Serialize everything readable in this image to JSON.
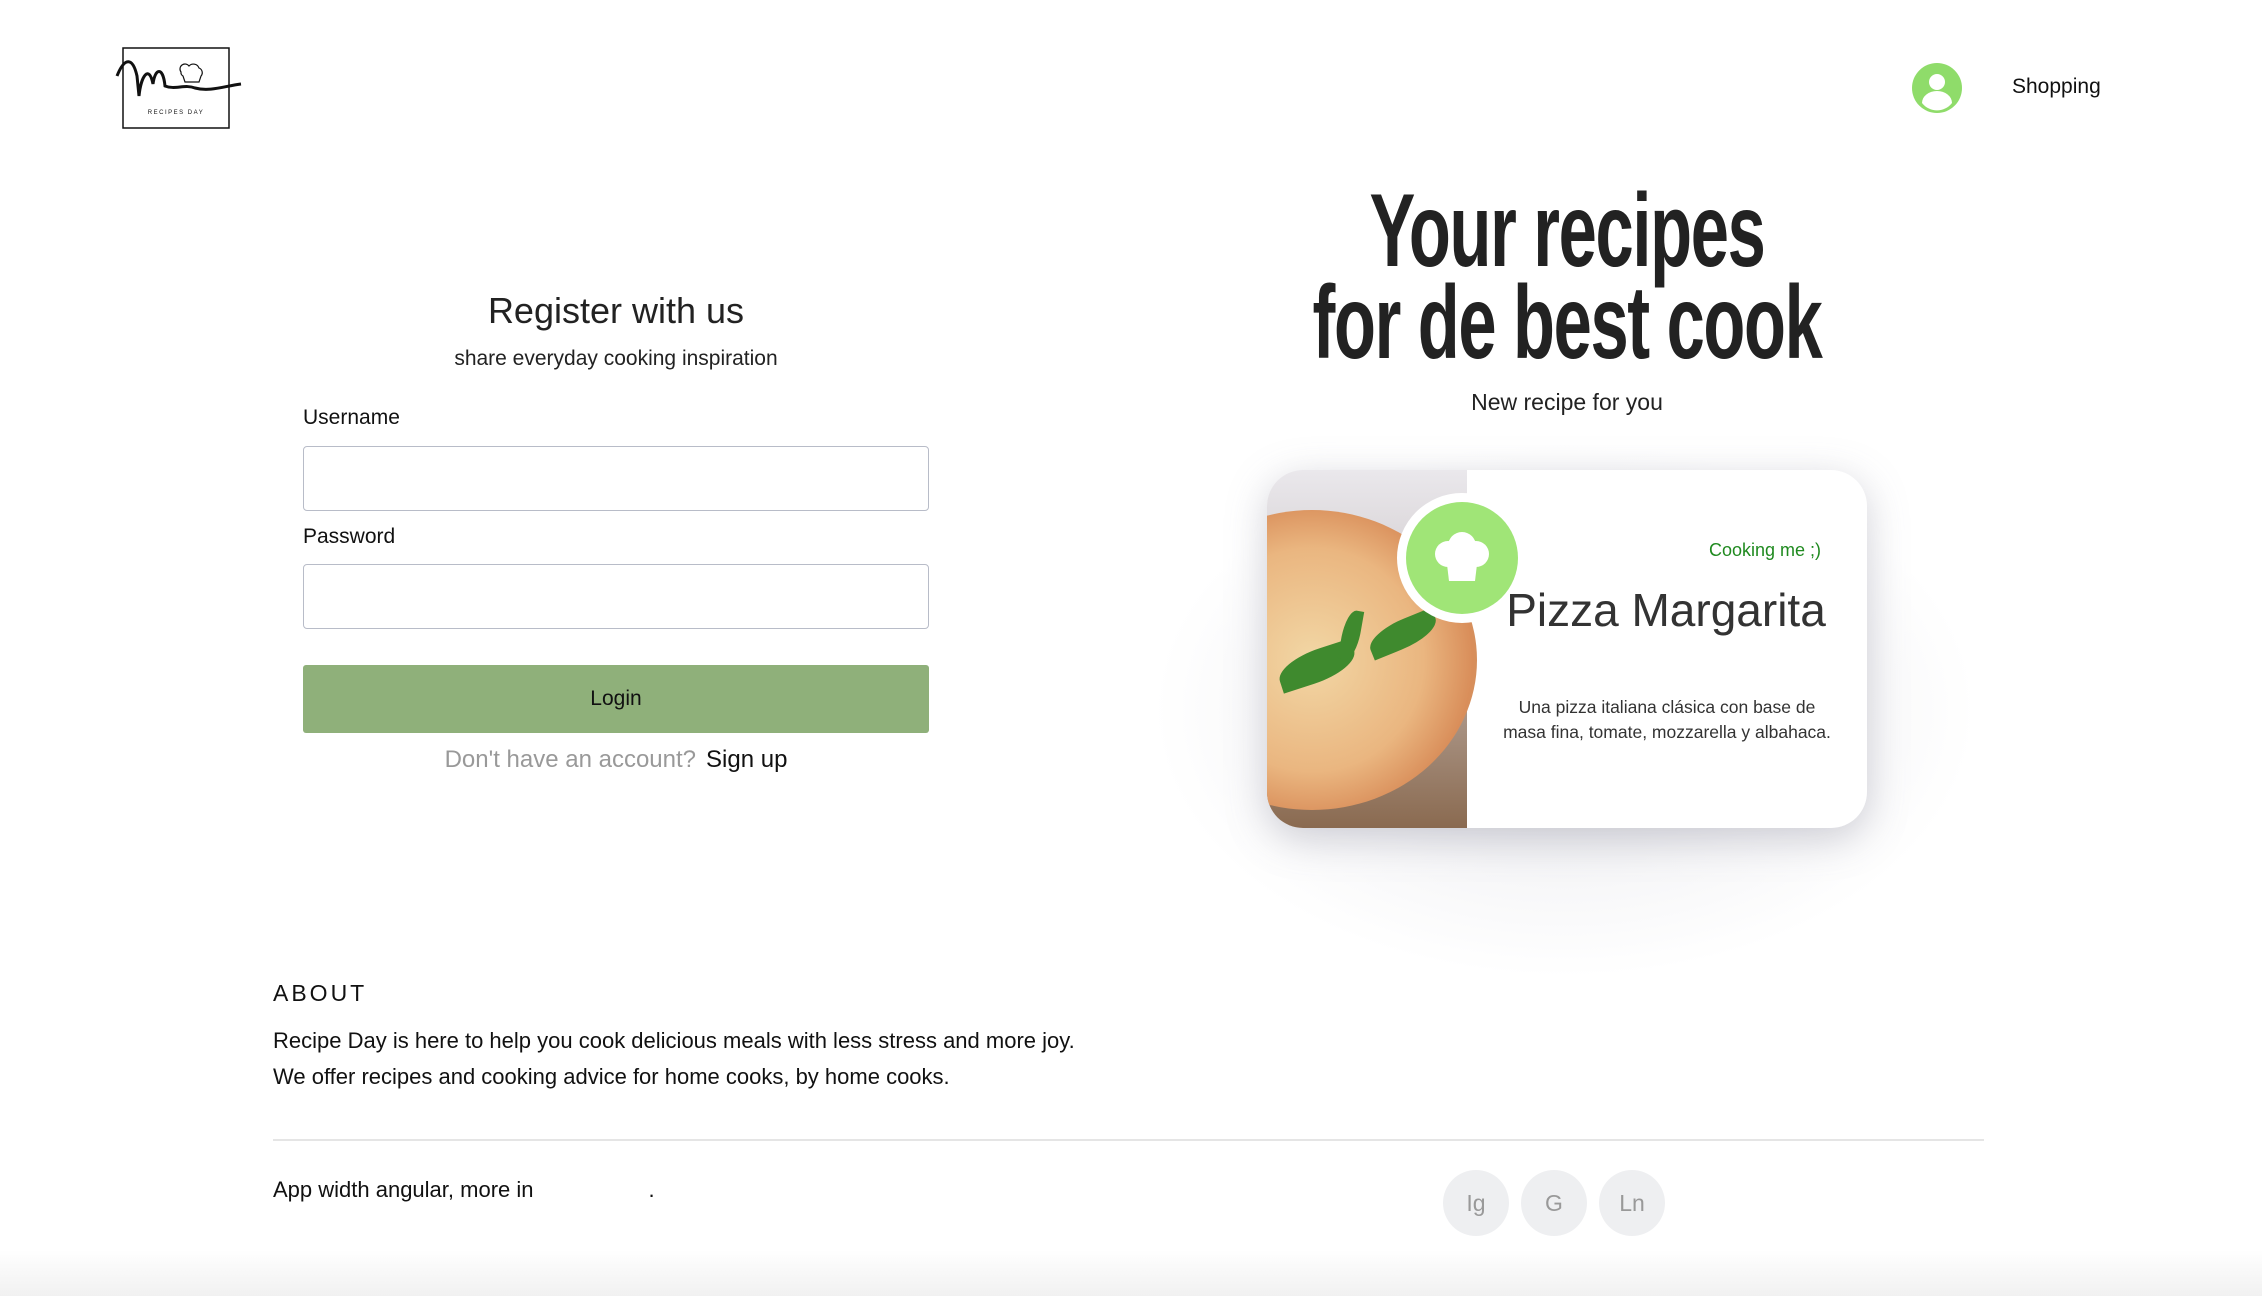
{
  "header": {
    "logo_text": "RECIPES DAY",
    "shopping_label": "Shopping"
  },
  "register": {
    "title": "Register with us",
    "subtitle": "share everyday cooking inspiration",
    "username_label": "Username",
    "username_value": "",
    "password_label": "Password",
    "password_value": "",
    "login_label": "Login",
    "no_account_text": "Don't have an account?",
    "signup_label": "Sign up"
  },
  "hero": {
    "headline_line1": "Your recipes",
    "headline_line2": "for de best cook",
    "subheading": "New recipe for you"
  },
  "recipe_card": {
    "badge": "Cooking me ;)",
    "title": "Pizza Margarita",
    "description": "Una pizza italiana clásica con base de masa fina, tomate, mozzarella y albahaca.",
    "icon": "chef-hat-icon",
    "accent": "#a0e577"
  },
  "about": {
    "heading": "ABOUT",
    "line1": "Recipe Day is here to help you cook delicious meals with less stress and more joy.",
    "line2": "We offer recipes and cooking advice for home cooks, by home cooks."
  },
  "footer": {
    "text": "App width angular, more in",
    "trailing": ".",
    "social": [
      {
        "label": "Ig"
      },
      {
        "label": "G"
      },
      {
        "label": "Ln"
      }
    ]
  },
  "colors": {
    "primary_button": "#8fb07a",
    "avatar": "#8fdc6a",
    "badge_text": "#1f8a1f"
  }
}
